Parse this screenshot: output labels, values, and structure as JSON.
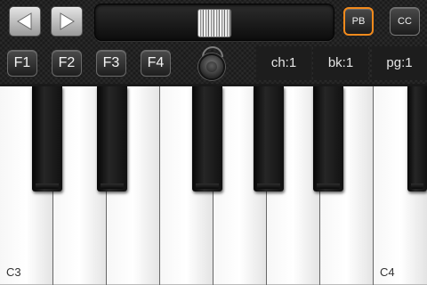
{
  "toolbar": {
    "prev_icon": "left-arrow-icon",
    "next_icon": "right-arrow-icon",
    "pitch_slider_level": 0.5,
    "pb_label": "PB",
    "cc_label": "CC",
    "active_mode": "PB",
    "accent_color": "#f28a1c"
  },
  "function_keys": [
    "F1",
    "F2",
    "F3",
    "F4"
  ],
  "knob_icon": "knob-icon",
  "readouts": {
    "channel": "ch:1",
    "bank": "bk:1",
    "program": "pg:1"
  },
  "keyboard": {
    "white_key_count": 8,
    "labels": {
      "first": "C3",
      "last": "C4"
    }
  }
}
